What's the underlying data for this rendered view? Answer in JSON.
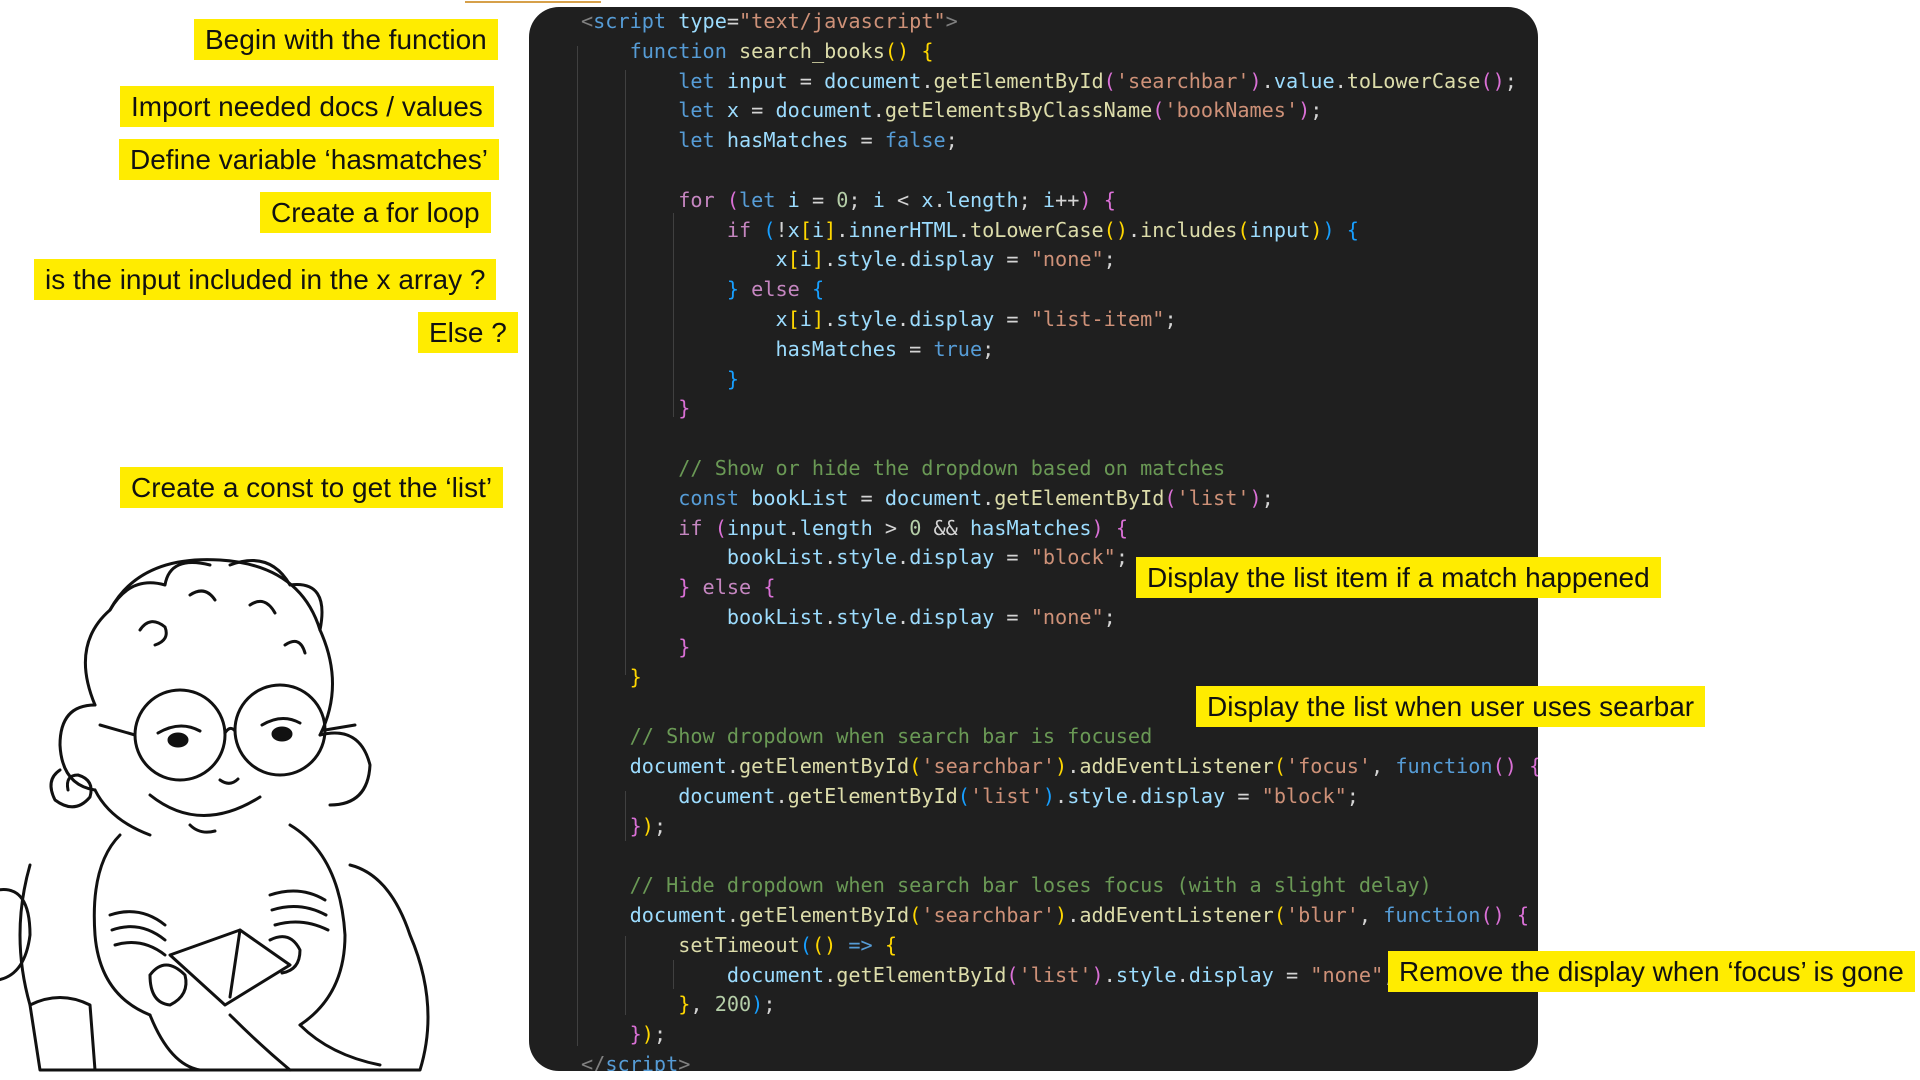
{
  "annotations": [
    {
      "id": "begin",
      "text": "Begin with the function"
    },
    {
      "id": "import",
      "text": "Import needed docs / values"
    },
    {
      "id": "define",
      "text": "Define variable ‘hasmatches’"
    },
    {
      "id": "forloop",
      "text": "Create a for loop"
    },
    {
      "id": "included",
      "text": "is the input included in the x array ?"
    },
    {
      "id": "else",
      "text": "Else ?"
    },
    {
      "id": "const",
      "text": "Create a const to get the ‘list’"
    },
    {
      "id": "display_match",
      "text": "Display the list item if a match happened"
    },
    {
      "id": "display_searchbar",
      "text": "Display the list when user uses searbar"
    },
    {
      "id": "remove_display",
      "text": "Remove the display when ‘focus’ is gone"
    }
  ],
  "code": {
    "lines": [
      [
        [
          "tag",
          "<"
        ],
        [
          "kw",
          "script"
        ],
        [
          "p",
          " "
        ],
        [
          "var",
          "type"
        ],
        [
          "p",
          "="
        ],
        [
          "str",
          "\"text/javascript\""
        ],
        [
          "tag",
          ">"
        ]
      ],
      [
        [
          "p",
          "    "
        ],
        [
          "kw",
          "function"
        ],
        [
          "p",
          " "
        ],
        [
          "fn",
          "search_books"
        ],
        [
          "b1",
          "()"
        ],
        [
          "p",
          " "
        ],
        [
          "b1",
          "{"
        ]
      ],
      [
        [
          "p",
          "        "
        ],
        [
          "kw",
          "let"
        ],
        [
          "p",
          " "
        ],
        [
          "var",
          "input"
        ],
        [
          "p",
          " = "
        ],
        [
          "var",
          "document"
        ],
        [
          "p",
          "."
        ],
        [
          "fn",
          "getElementById"
        ],
        [
          "b2",
          "("
        ],
        [
          "str",
          "'searchbar'"
        ],
        [
          "b2",
          ")"
        ],
        [
          "p",
          "."
        ],
        [
          "var",
          "value"
        ],
        [
          "p",
          "."
        ],
        [
          "fn",
          "toLowerCase"
        ],
        [
          "b2",
          "()"
        ],
        [
          "p",
          ";"
        ]
      ],
      [
        [
          "p",
          "        "
        ],
        [
          "kw",
          "let"
        ],
        [
          "p",
          " "
        ],
        [
          "var",
          "x"
        ],
        [
          "p",
          " = "
        ],
        [
          "var",
          "document"
        ],
        [
          "p",
          "."
        ],
        [
          "fn",
          "getElementsByClassName"
        ],
        [
          "b2",
          "("
        ],
        [
          "str",
          "'bookNames'"
        ],
        [
          "b2",
          ")"
        ],
        [
          "p",
          ";"
        ]
      ],
      [
        [
          "p",
          "        "
        ],
        [
          "kw",
          "let"
        ],
        [
          "p",
          " "
        ],
        [
          "var",
          "hasMatches"
        ],
        [
          "p",
          " = "
        ],
        [
          "kw",
          "false"
        ],
        [
          "p",
          ";"
        ]
      ],
      [],
      [
        [
          "p",
          "        "
        ],
        [
          "ctl",
          "for"
        ],
        [
          "p",
          " "
        ],
        [
          "b2",
          "("
        ],
        [
          "kw",
          "let"
        ],
        [
          "p",
          " "
        ],
        [
          "var",
          "i"
        ],
        [
          "p",
          " = "
        ],
        [
          "num",
          "0"
        ],
        [
          "p",
          "; "
        ],
        [
          "var",
          "i"
        ],
        [
          "p",
          " < "
        ],
        [
          "var",
          "x"
        ],
        [
          "p",
          "."
        ],
        [
          "var",
          "length"
        ],
        [
          "p",
          "; "
        ],
        [
          "var",
          "i"
        ],
        [
          "p",
          "++"
        ],
        [
          "b2",
          ")"
        ],
        [
          "p",
          " "
        ],
        [
          "b2",
          "{"
        ]
      ],
      [
        [
          "p",
          "            "
        ],
        [
          "ctl",
          "if"
        ],
        [
          "p",
          " "
        ],
        [
          "b3",
          "("
        ],
        [
          "p",
          "!"
        ],
        [
          "var",
          "x"
        ],
        [
          "b1",
          "["
        ],
        [
          "var",
          "i"
        ],
        [
          "b1",
          "]"
        ],
        [
          "p",
          "."
        ],
        [
          "var",
          "innerHTML"
        ],
        [
          "p",
          "."
        ],
        [
          "fn",
          "toLowerCase"
        ],
        [
          "b1",
          "()"
        ],
        [
          "p",
          "."
        ],
        [
          "fn",
          "includes"
        ],
        [
          "b1",
          "("
        ],
        [
          "var",
          "input"
        ],
        [
          "b1",
          ")"
        ],
        [
          "b3",
          ")"
        ],
        [
          "p",
          " "
        ],
        [
          "b3",
          "{"
        ]
      ],
      [
        [
          "p",
          "                "
        ],
        [
          "var",
          "x"
        ],
        [
          "b1",
          "["
        ],
        [
          "var",
          "i"
        ],
        [
          "b1",
          "]"
        ],
        [
          "p",
          "."
        ],
        [
          "var",
          "style"
        ],
        [
          "p",
          "."
        ],
        [
          "var",
          "display"
        ],
        [
          "p",
          " = "
        ],
        [
          "str",
          "\"none\""
        ],
        [
          "p",
          ";"
        ]
      ],
      [
        [
          "p",
          "            "
        ],
        [
          "b3",
          "}"
        ],
        [
          "p",
          " "
        ],
        [
          "ctl",
          "else"
        ],
        [
          "p",
          " "
        ],
        [
          "b3",
          "{"
        ]
      ],
      [
        [
          "p",
          "                "
        ],
        [
          "var",
          "x"
        ],
        [
          "b1",
          "["
        ],
        [
          "var",
          "i"
        ],
        [
          "b1",
          "]"
        ],
        [
          "p",
          "."
        ],
        [
          "var",
          "style"
        ],
        [
          "p",
          "."
        ],
        [
          "var",
          "display"
        ],
        [
          "p",
          " = "
        ],
        [
          "str",
          "\"list-item\""
        ],
        [
          "p",
          ";"
        ]
      ],
      [
        [
          "p",
          "                "
        ],
        [
          "var",
          "hasMatches"
        ],
        [
          "p",
          " = "
        ],
        [
          "kw",
          "true"
        ],
        [
          "p",
          ";"
        ]
      ],
      [
        [
          "p",
          "            "
        ],
        [
          "b3",
          "}"
        ]
      ],
      [
        [
          "p",
          "        "
        ],
        [
          "b2",
          "}"
        ]
      ],
      [],
      [
        [
          "p",
          "        "
        ],
        [
          "com",
          "// Show or hide the dropdown based on matches"
        ]
      ],
      [
        [
          "p",
          "        "
        ],
        [
          "kw",
          "const"
        ],
        [
          "p",
          " "
        ],
        [
          "var",
          "bookList"
        ],
        [
          "p",
          " = "
        ],
        [
          "var",
          "document"
        ],
        [
          "p",
          "."
        ],
        [
          "fn",
          "getElementById"
        ],
        [
          "b2",
          "("
        ],
        [
          "str",
          "'list'"
        ],
        [
          "b2",
          ")"
        ],
        [
          "p",
          ";"
        ]
      ],
      [
        [
          "p",
          "        "
        ],
        [
          "ctl",
          "if"
        ],
        [
          "p",
          " "
        ],
        [
          "b2",
          "("
        ],
        [
          "var",
          "input"
        ],
        [
          "p",
          "."
        ],
        [
          "var",
          "length"
        ],
        [
          "p",
          " > "
        ],
        [
          "num",
          "0"
        ],
        [
          "p",
          " && "
        ],
        [
          "var",
          "hasMatches"
        ],
        [
          "b2",
          ")"
        ],
        [
          "p",
          " "
        ],
        [
          "b2",
          "{"
        ]
      ],
      [
        [
          "p",
          "            "
        ],
        [
          "var",
          "bookList"
        ],
        [
          "p",
          "."
        ],
        [
          "var",
          "style"
        ],
        [
          "p",
          "."
        ],
        [
          "var",
          "display"
        ],
        [
          "p",
          " = "
        ],
        [
          "str",
          "\"block\""
        ],
        [
          "p",
          ";"
        ]
      ],
      [
        [
          "p",
          "        "
        ],
        [
          "b2",
          "}"
        ],
        [
          "p",
          " "
        ],
        [
          "ctl",
          "else"
        ],
        [
          "p",
          " "
        ],
        [
          "b2",
          "{"
        ]
      ],
      [
        [
          "p",
          "            "
        ],
        [
          "var",
          "bookList"
        ],
        [
          "p",
          "."
        ],
        [
          "var",
          "style"
        ],
        [
          "p",
          "."
        ],
        [
          "var",
          "display"
        ],
        [
          "p",
          " = "
        ],
        [
          "str",
          "\"none\""
        ],
        [
          "p",
          ";"
        ]
      ],
      [
        [
          "p",
          "        "
        ],
        [
          "b2",
          "}"
        ]
      ],
      [
        [
          "p",
          "    "
        ],
        [
          "b1",
          "}"
        ]
      ],
      [],
      [
        [
          "p",
          "    "
        ],
        [
          "com",
          "// Show dropdown when search bar is focused"
        ]
      ],
      [
        [
          "p",
          "    "
        ],
        [
          "var",
          "document"
        ],
        [
          "p",
          "."
        ],
        [
          "fn",
          "getElementById"
        ],
        [
          "b1",
          "("
        ],
        [
          "str",
          "'searchbar'"
        ],
        [
          "b1",
          ")"
        ],
        [
          "p",
          "."
        ],
        [
          "fn",
          "addEventListener"
        ],
        [
          "b1",
          "("
        ],
        [
          "str",
          "'focus'"
        ],
        [
          "p",
          ", "
        ],
        [
          "kw",
          "function"
        ],
        [
          "b2",
          "()"
        ],
        [
          "p",
          " "
        ],
        [
          "b2",
          "{"
        ]
      ],
      [
        [
          "p",
          "        "
        ],
        [
          "var",
          "document"
        ],
        [
          "p",
          "."
        ],
        [
          "fn",
          "getElementById"
        ],
        [
          "b3",
          "("
        ],
        [
          "str",
          "'list'"
        ],
        [
          "b3",
          ")"
        ],
        [
          "p",
          "."
        ],
        [
          "var",
          "style"
        ],
        [
          "p",
          "."
        ],
        [
          "var",
          "display"
        ],
        [
          "p",
          " = "
        ],
        [
          "str",
          "\"block\""
        ],
        [
          "p",
          ";"
        ]
      ],
      [
        [
          "p",
          "    "
        ],
        [
          "b2",
          "}"
        ],
        [
          "b1",
          ")"
        ],
        [
          "p",
          ";"
        ]
      ],
      [],
      [
        [
          "p",
          "    "
        ],
        [
          "com",
          "// Hide dropdown when search bar loses focus (with a slight delay)"
        ]
      ],
      [
        [
          "p",
          "    "
        ],
        [
          "var",
          "document"
        ],
        [
          "p",
          "."
        ],
        [
          "fn",
          "getElementById"
        ],
        [
          "b1",
          "("
        ],
        [
          "str",
          "'searchbar'"
        ],
        [
          "b1",
          ")"
        ],
        [
          "p",
          "."
        ],
        [
          "fn",
          "addEventListener"
        ],
        [
          "b1",
          "("
        ],
        [
          "str",
          "'blur'"
        ],
        [
          "p",
          ", "
        ],
        [
          "kw",
          "function"
        ],
        [
          "b2",
          "()"
        ],
        [
          "p",
          " "
        ],
        [
          "b2",
          "{"
        ]
      ],
      [
        [
          "p",
          "        "
        ],
        [
          "fn",
          "setTimeout"
        ],
        [
          "b3",
          "("
        ],
        [
          "b1",
          "()"
        ],
        [
          "p",
          " "
        ],
        [
          "kw",
          "=>"
        ],
        [
          "p",
          " "
        ],
        [
          "b1",
          "{"
        ]
      ],
      [
        [
          "p",
          "            "
        ],
        [
          "var",
          "document"
        ],
        [
          "p",
          "."
        ],
        [
          "fn",
          "getElementById"
        ],
        [
          "b2",
          "("
        ],
        [
          "str",
          "'list'"
        ],
        [
          "b2",
          ")"
        ],
        [
          "p",
          "."
        ],
        [
          "var",
          "style"
        ],
        [
          "p",
          "."
        ],
        [
          "var",
          "display"
        ],
        [
          "p",
          " = "
        ],
        [
          "str",
          "\"none\""
        ],
        [
          "p",
          ";"
        ]
      ],
      [
        [
          "p",
          "        "
        ],
        [
          "b1",
          "}"
        ],
        [
          "p",
          ", "
        ],
        [
          "num",
          "200"
        ],
        [
          "b3",
          ")"
        ],
        [
          "p",
          ";"
        ]
      ],
      [
        [
          "p",
          "    "
        ],
        [
          "b2",
          "}"
        ],
        [
          "b1",
          ")"
        ],
        [
          "p",
          ";"
        ]
      ],
      [
        [
          "tag",
          "</"
        ],
        [
          "kw",
          "script"
        ],
        [
          "tag",
          ">"
        ]
      ]
    ]
  },
  "illustration": {
    "icon": "cartoon-reader-with-glasses-icon"
  },
  "colors": {
    "highlight": "#ffec00",
    "editor_bg": "#1f1f1f",
    "page_bg": "#ffffff"
  }
}
